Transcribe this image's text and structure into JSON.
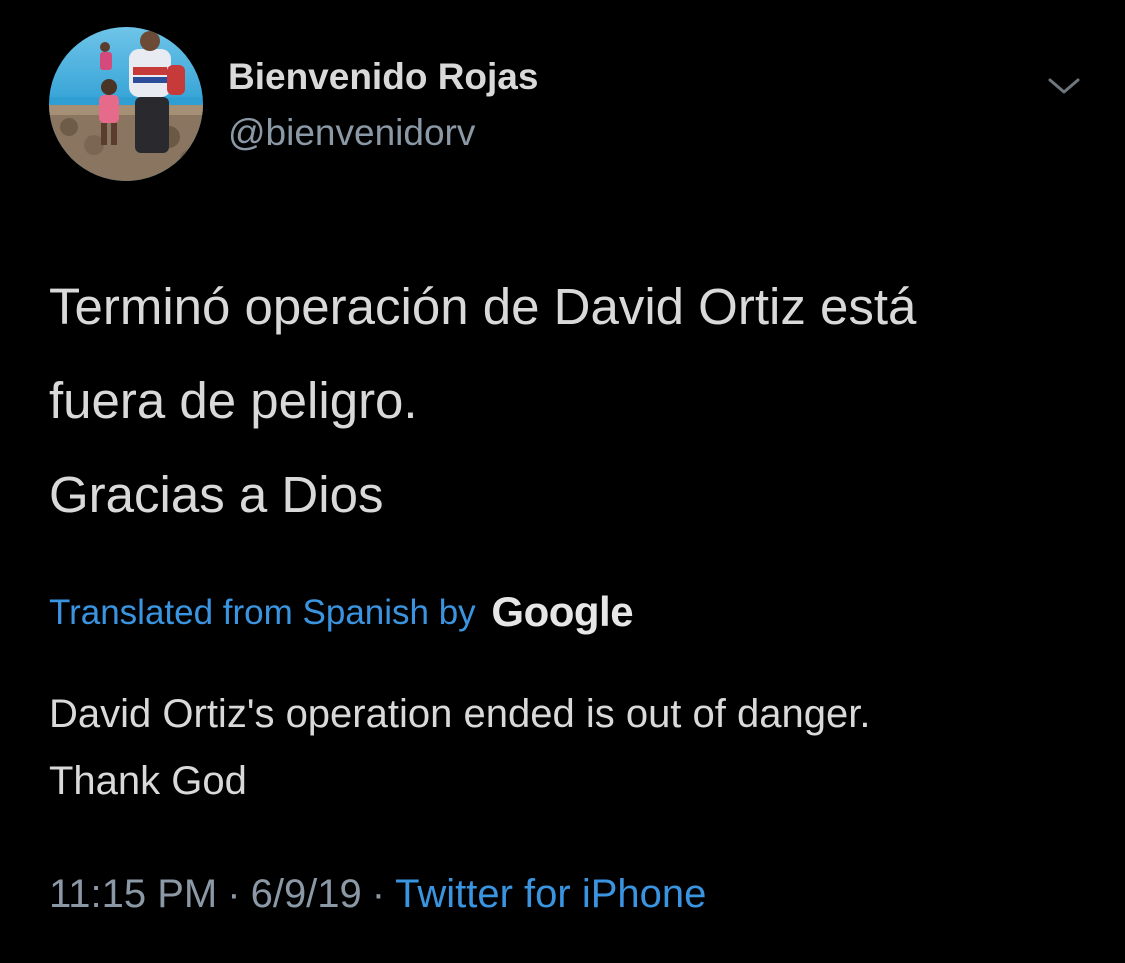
{
  "author": {
    "display_name": "Bienvenido Rojas",
    "handle": "@bienvenidorv",
    "avatar_icon": "profile-photo"
  },
  "menu": {
    "icon": "chevron-down-icon"
  },
  "tweet": {
    "lines": [
      "Terminó operación de David Ortiz está",
      "fuera de peligro.",
      "Gracias a Dios"
    ]
  },
  "translation": {
    "label": "Translated from Spanish by",
    "provider": "Google",
    "lines": [
      "David Ortiz's operation ended is out of danger.",
      "Thank God"
    ]
  },
  "meta": {
    "time": "11:15 PM",
    "separator": "·",
    "date": "6/9/19",
    "source": "Twitter for iPhone"
  },
  "colors": {
    "background": "#000000",
    "primary_text": "#d9d9d9",
    "secondary_text": "#8b98a5",
    "link": "#3a94e0"
  }
}
